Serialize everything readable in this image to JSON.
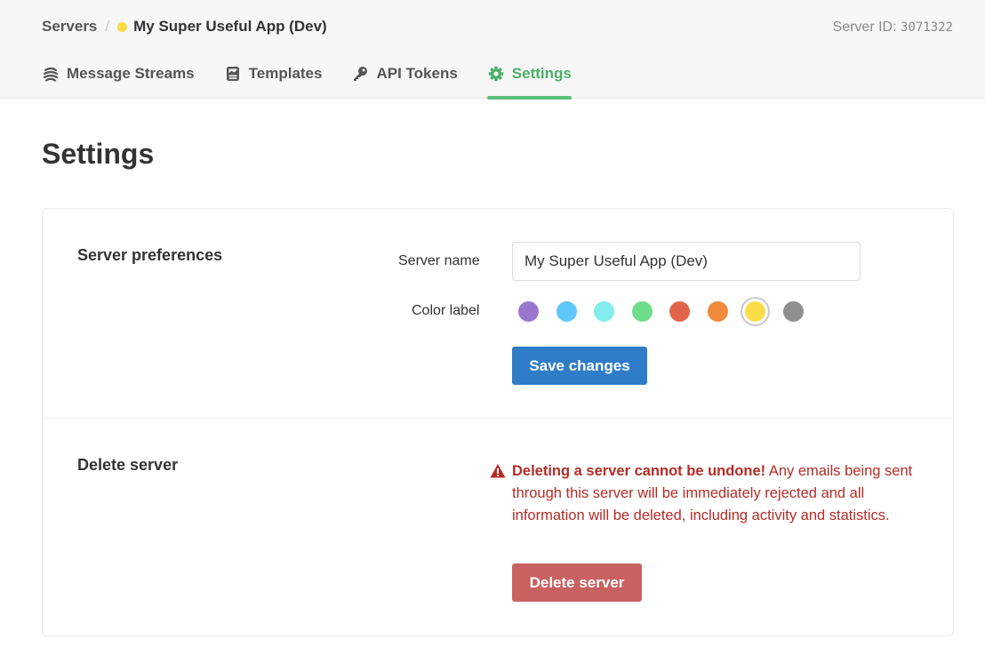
{
  "breadcrumb": {
    "root": "Servers",
    "separator": "/",
    "current": "My Super Useful App (Dev)",
    "current_color": "#fcdb4a"
  },
  "server_id": {
    "label": "Server ID:",
    "value": "3071322"
  },
  "tabs": [
    {
      "label": "Message Streams",
      "icon": "streams-icon",
      "active": false
    },
    {
      "label": "Templates",
      "icon": "template-icon",
      "active": false
    },
    {
      "label": "API Tokens",
      "icon": "key-icon",
      "active": false
    },
    {
      "label": "Settings",
      "icon": "gear-icon",
      "active": true
    }
  ],
  "page_title": "Settings",
  "preferences": {
    "title": "Server preferences",
    "name_label": "Server name",
    "name_value": "My Super Useful App (Dev)",
    "color_label": "Color label",
    "colors": [
      {
        "name": "purple",
        "hex": "#9a77cf",
        "selected": false
      },
      {
        "name": "blue",
        "hex": "#5ec8fa",
        "selected": false
      },
      {
        "name": "cyan",
        "hex": "#84ecec",
        "selected": false
      },
      {
        "name": "green",
        "hex": "#6edc8a",
        "selected": false
      },
      {
        "name": "red",
        "hex": "#e2654b",
        "selected": false
      },
      {
        "name": "orange",
        "hex": "#f08a3c",
        "selected": false
      },
      {
        "name": "yellow",
        "hex": "#fbdd4a",
        "selected": true
      },
      {
        "name": "gray",
        "hex": "#8f8f8f",
        "selected": false
      }
    ],
    "save_label": "Save changes"
  },
  "delete": {
    "title": "Delete server",
    "warning_bold": "Deleting a server cannot be undone!",
    "warning_text": " Any emails being sent through this server will be immediately rejected and all information will be deleted, including activity and statistics.",
    "button_label": "Delete server"
  },
  "colors": {
    "accent_green": "#4aaf6a",
    "primary_blue": "#2f7cc8",
    "danger_red": "#c96161",
    "warning_text": "#b52b26"
  }
}
